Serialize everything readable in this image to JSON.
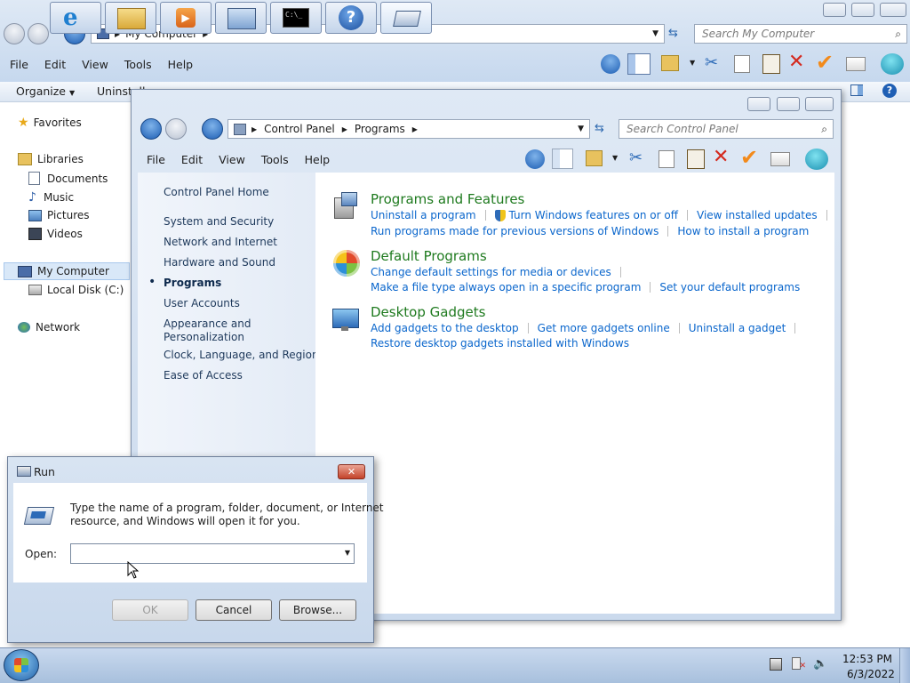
{
  "explorer": {
    "address": "My Computer",
    "search_placeholder": "Search My Computer",
    "menu": [
      "File",
      "Edit",
      "View",
      "Tools",
      "Help"
    ],
    "toolbar": {
      "organize": "Organize",
      "uninstall": "Uninstall"
    },
    "nav": {
      "favorites": "Favorites",
      "libraries": "Libraries",
      "documents": "Documents",
      "music": "Music",
      "pictures": "Pictures",
      "videos": "Videos",
      "my_computer": "My Computer",
      "local_disk": "Local Disk (C:)",
      "network": "Network"
    }
  },
  "control_panel": {
    "breadcrumb": [
      "Control Panel",
      "Programs"
    ],
    "search_placeholder": "Search Control Panel",
    "menu": [
      "File",
      "Edit",
      "View",
      "Tools",
      "Help"
    ],
    "nav": {
      "home": "Control Panel Home",
      "items": [
        "System and Security",
        "Network and Internet",
        "Hardware and Sound",
        "Programs",
        "User Accounts",
        "Appearance and Personalization",
        "Clock, Language, and Region",
        "Ease of Access"
      ],
      "current": "Programs"
    },
    "sections": {
      "programs_features": {
        "title": "Programs and Features",
        "links": [
          "Uninstall a program",
          "Turn Windows features on or off",
          "View installed updates",
          "Run programs made for previous versions of Windows",
          "How to install a program"
        ]
      },
      "default_programs": {
        "title": "Default Programs",
        "links": [
          "Change default settings for media or devices",
          "Make a file type always open in a specific program",
          "Set your default programs"
        ]
      },
      "desktop_gadgets": {
        "title": "Desktop Gadgets",
        "links": [
          "Add gadgets to the desktop",
          "Get more gadgets online",
          "Uninstall a gadget",
          "Restore desktop gadgets installed with Windows"
        ]
      }
    }
  },
  "run_dialog": {
    "title": "Run",
    "description_line1": "Type the name of a program, folder, document, or Internet",
    "description_line2": "resource, and Windows will open it for you.",
    "open_label": "Open:",
    "open_value": "",
    "ok": "OK",
    "cancel": "Cancel",
    "browse": "Browse..."
  },
  "taskbar": {
    "time": "12:53 PM",
    "date": "6/3/2022"
  },
  "colors": {
    "link": "#0a66cc",
    "section_heading": "#1e7a1e",
    "nav_text": "#1e395b",
    "taskbar": "#b8cde6"
  }
}
